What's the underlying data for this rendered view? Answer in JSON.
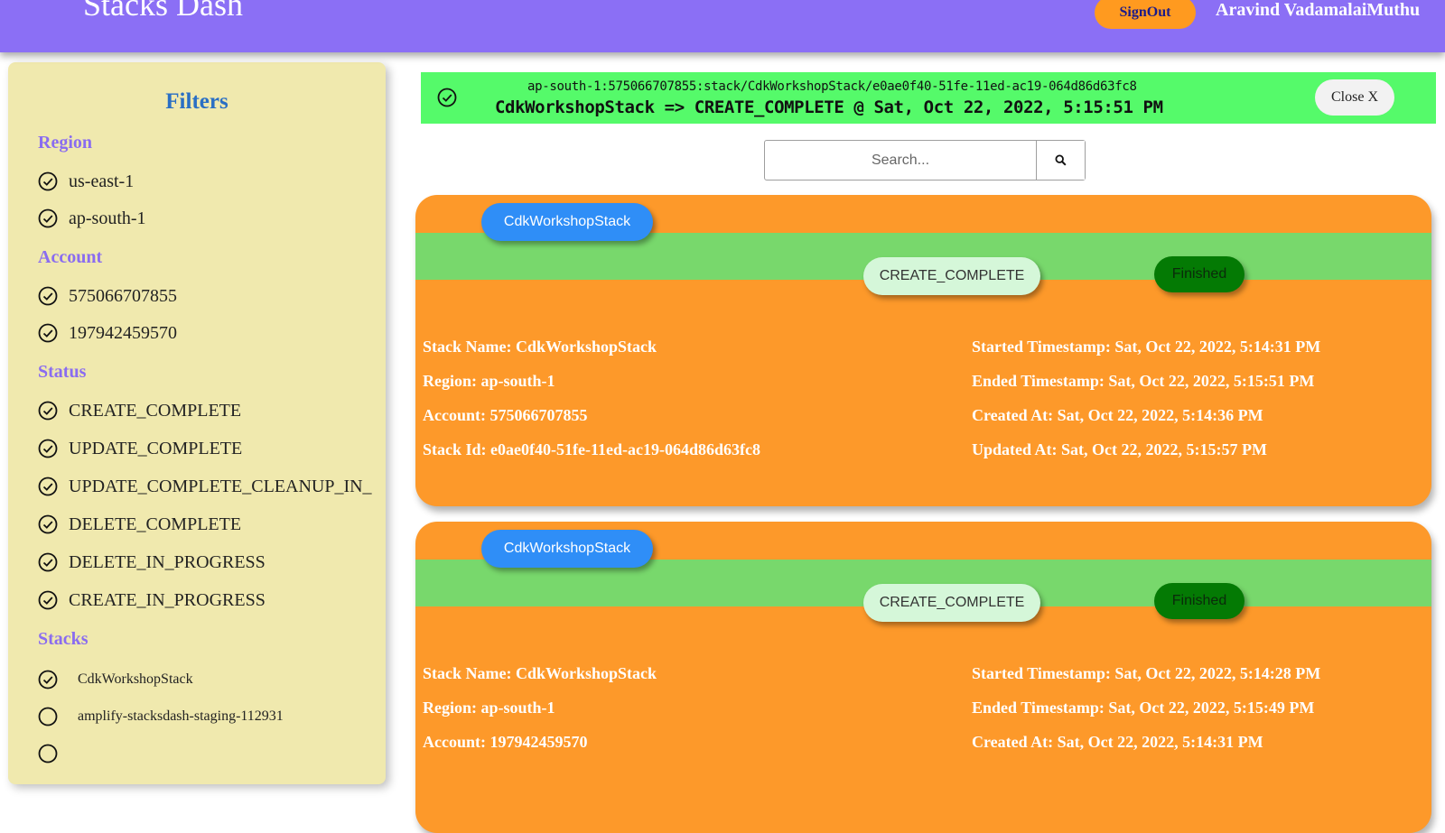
{
  "header": {
    "title": "Stacks Dash",
    "signout_label": "SignOut",
    "user": "Aravind VadamalaiMuthu"
  },
  "sidebar": {
    "title": "Filters",
    "sections": {
      "region": {
        "title": "Region",
        "items": [
          "us-east-1",
          "ap-south-1"
        ]
      },
      "account": {
        "title": "Account",
        "items": [
          "575066707855",
          "197942459570"
        ]
      },
      "status": {
        "title": "Status",
        "items": [
          "CREATE_COMPLETE",
          "UPDATE_COMPLETE",
          "UPDATE_COMPLETE_CLEANUP_IN_",
          "DELETE_COMPLETE",
          "DELETE_IN_PROGRESS",
          "CREATE_IN_PROGRESS"
        ]
      },
      "stacks": {
        "title": "Stacks",
        "items": [
          {
            "label": "CdkWorkshopStack",
            "checked": true
          },
          {
            "label": "amplify-stacksdash-staging-112931",
            "checked": false
          }
        ]
      }
    }
  },
  "notification": {
    "stack_id": "ap-south-1:575066707855:stack/CdkWorkshopStack/e0ae0f40-51fe-11ed-ac19-064d86d63fc8",
    "message": "CdkWorkshopStack => CREATE_COMPLETE @ Sat, Oct 22, 2022, 5:15:51 PM",
    "close_label": "Close X",
    "color": "#55fa6a"
  },
  "search": {
    "placeholder": "Search..."
  },
  "cards": [
    {
      "stack_label": "CdkWorkshopStack",
      "status": "CREATE_COMPLETE",
      "state": "Finished",
      "stack_name": "Stack Name: CdkWorkshopStack",
      "region": "Region: ap-south-1",
      "account": "Account: 575066707855",
      "stack_id": "Stack Id: e0ae0f40-51fe-11ed-ac19-064d86d63fc8",
      "started": "Started Timestamp: Sat, Oct 22, 2022, 5:14:31 PM",
      "ended": "Ended Timestamp: Sat, Oct 22, 2022, 5:15:51 PM",
      "created": "Created At: Sat, Oct 22, 2022, 5:14:36 PM",
      "updated": "Updated At: Sat, Oct 22, 2022, 5:15:57 PM"
    },
    {
      "stack_label": "CdkWorkshopStack",
      "status": "CREATE_COMPLETE",
      "state": "Finished",
      "stack_name": "Stack Name: CdkWorkshopStack",
      "region": "Region: ap-south-1",
      "account": "Account: 197942459570",
      "started": "Started Timestamp: Sat, Oct 22, 2022, 5:14:28 PM",
      "ended": "Ended Timestamp: Sat, Oct 22, 2022, 5:15:49 PM",
      "created": "Created At: Sat, Oct 22, 2022, 5:14:31 PM"
    }
  ],
  "colors": {
    "header": "#8b6ff5",
    "sidebar": "#f0e9ae",
    "card": "#fd992a",
    "band": "#78d86c",
    "accent_blue": "#2f8ef7",
    "finished": "#047a04"
  }
}
